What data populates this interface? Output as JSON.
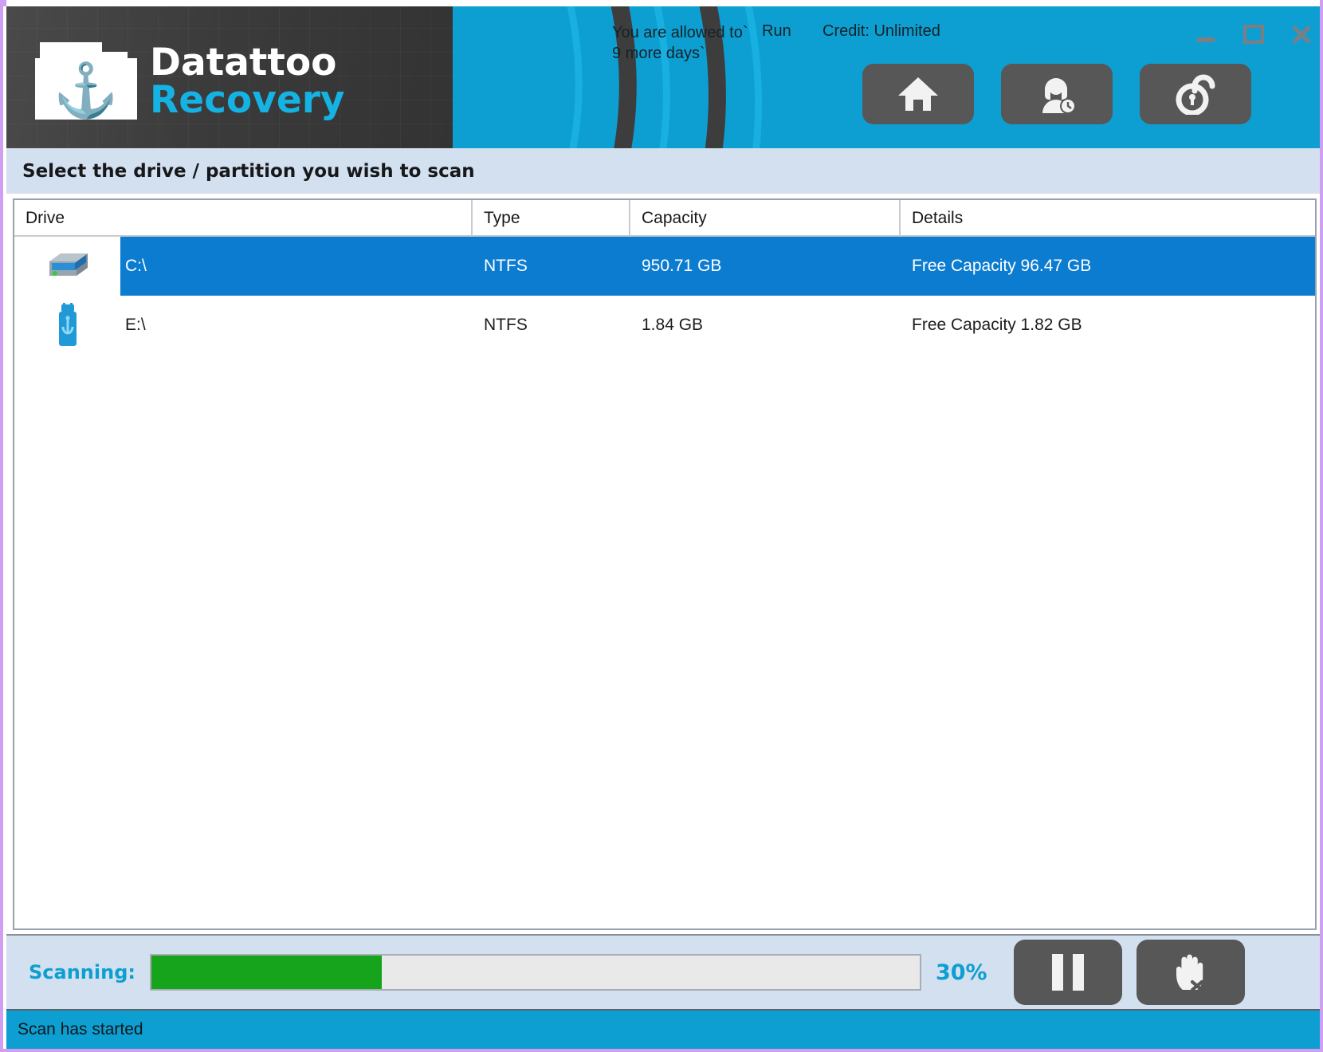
{
  "window": {
    "controls": {
      "minimize": "minimize",
      "maximize": "maximize",
      "close": "close"
    },
    "border_color": "#cf9ff2"
  },
  "header": {
    "logo_line1": "Datattoo",
    "logo_line2": "Recovery",
    "logo_icon": "folder-anchor-icon",
    "allowed_note": "You are allowed to`\n9 more days`",
    "run_label": "Run",
    "credit_label": "Credit: Unlimited",
    "accent_color": "#0d9fd1",
    "buttons": [
      {
        "name": "home-button",
        "icon": "home-icon"
      },
      {
        "name": "support-button",
        "icon": "headset-person-icon"
      },
      {
        "name": "unlock-button",
        "icon": "padlock-unlock-icon"
      }
    ]
  },
  "subtitle": {
    "text": "Select the drive / partition you wish to scan"
  },
  "table": {
    "columns": [
      "Drive",
      "Type",
      "Capacity",
      "Details"
    ],
    "rows": [
      {
        "icon": "hard-disk-icon",
        "drive": "C:\\",
        "type": "NTFS",
        "capacity": "950.71 GB",
        "details": "Free Capacity 96.47 GB",
        "selected": true
      },
      {
        "icon": "usb-flash-drive-icon",
        "drive": "E:\\",
        "type": "NTFS",
        "capacity": "1.84 GB",
        "details": "Free Capacity 1.82 GB",
        "selected": false
      }
    ]
  },
  "progress": {
    "label": "Scanning:",
    "percent_text": "30%",
    "percent_value": 30,
    "fill_color": "#16a41c",
    "text_color": "#0d9fd1",
    "buttons": [
      {
        "name": "pause-button",
        "icon": "pause-icon"
      },
      {
        "name": "stop-button",
        "icon": "hand-stop-icon"
      }
    ]
  },
  "status": {
    "text": "Scan has started"
  }
}
